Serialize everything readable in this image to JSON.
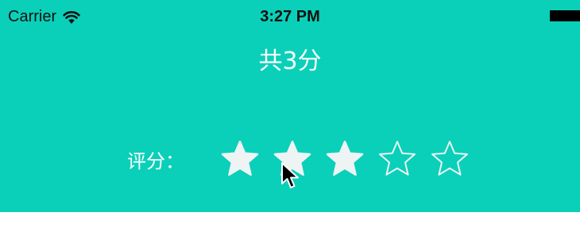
{
  "status_bar": {
    "carrier": "Carrier",
    "time": "3:27 PM",
    "wifi_icon": "wifi-icon",
    "battery_icon": "battery-icon"
  },
  "title": "共3分",
  "rating": {
    "label": "评分：",
    "value": 3,
    "max": 5,
    "star_icon": "star-icon"
  },
  "colors": {
    "background": "#0ad0b9",
    "star_fill": "#eef3f4",
    "text": "#ffffff"
  }
}
